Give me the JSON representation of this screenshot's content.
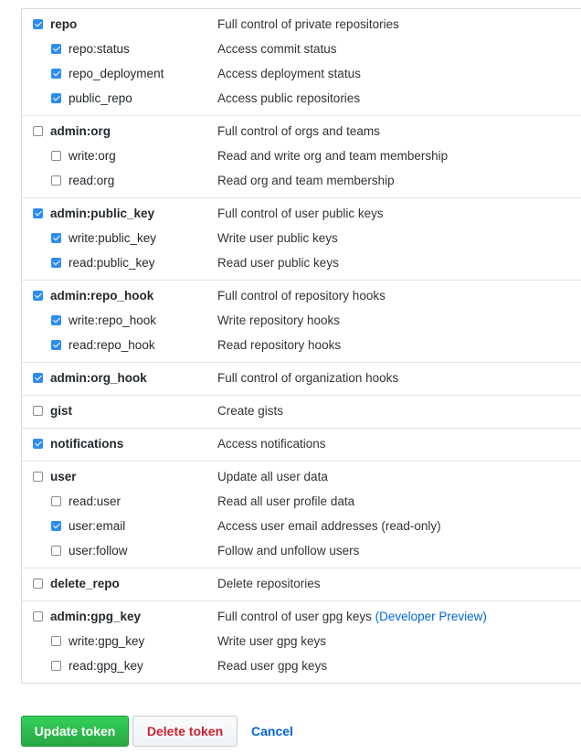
{
  "groups": [
    {
      "items": [
        {
          "name": "repo",
          "desc": "Full control of private repositories",
          "checked": true,
          "top": true
        },
        {
          "name": "repo:status",
          "desc": "Access commit status",
          "checked": true
        },
        {
          "name": "repo_deployment",
          "desc": "Access deployment status",
          "checked": true
        },
        {
          "name": "public_repo",
          "desc": "Access public repositories",
          "checked": true
        }
      ]
    },
    {
      "items": [
        {
          "name": "admin:org",
          "desc": "Full control of orgs and teams",
          "checked": false,
          "top": true
        },
        {
          "name": "write:org",
          "desc": "Read and write org and team membership",
          "checked": false
        },
        {
          "name": "read:org",
          "desc": "Read org and team membership",
          "checked": false
        }
      ]
    },
    {
      "items": [
        {
          "name": "admin:public_key",
          "desc": "Full control of user public keys",
          "checked": true,
          "top": true
        },
        {
          "name": "write:public_key",
          "desc": "Write user public keys",
          "checked": true
        },
        {
          "name": "read:public_key",
          "desc": "Read user public keys",
          "checked": true
        }
      ]
    },
    {
      "items": [
        {
          "name": "admin:repo_hook",
          "desc": "Full control of repository hooks",
          "checked": true,
          "top": true
        },
        {
          "name": "write:repo_hook",
          "desc": "Write repository hooks",
          "checked": true
        },
        {
          "name": "read:repo_hook",
          "desc": "Read repository hooks",
          "checked": true
        }
      ]
    },
    {
      "items": [
        {
          "name": "admin:org_hook",
          "desc": "Full control of organization hooks",
          "checked": true,
          "top": true
        }
      ]
    },
    {
      "items": [
        {
          "name": "gist",
          "desc": "Create gists",
          "checked": false,
          "top": true
        }
      ]
    },
    {
      "items": [
        {
          "name": "notifications",
          "desc": "Access notifications",
          "checked": true,
          "top": true
        }
      ]
    },
    {
      "items": [
        {
          "name": "user",
          "desc": "Update all user data",
          "checked": false,
          "top": true
        },
        {
          "name": "read:user",
          "desc": "Read all user profile data",
          "checked": false
        },
        {
          "name": "user:email",
          "desc": "Access user email addresses (read-only)",
          "checked": true
        },
        {
          "name": "user:follow",
          "desc": "Follow and unfollow users",
          "checked": false
        }
      ]
    },
    {
      "items": [
        {
          "name": "delete_repo",
          "desc": "Delete repositories",
          "checked": false,
          "top": true
        }
      ]
    },
    {
      "items": [
        {
          "name": "admin:gpg_key",
          "desc": "Full control of user gpg keys",
          "desc_extra": "(Developer Preview)",
          "checked": false,
          "top": true
        },
        {
          "name": "write:gpg_key",
          "desc": "Write user gpg keys",
          "checked": false
        },
        {
          "name": "read:gpg_key",
          "desc": "Read user gpg keys",
          "checked": false
        }
      ]
    }
  ],
  "actions": {
    "update_label": "Update token",
    "delete_label": "Delete token",
    "cancel_label": "Cancel"
  },
  "colors": {
    "checked": "#2d8cf0",
    "primary": "#28a745",
    "danger": "#cb2431",
    "link": "#0366d6"
  }
}
